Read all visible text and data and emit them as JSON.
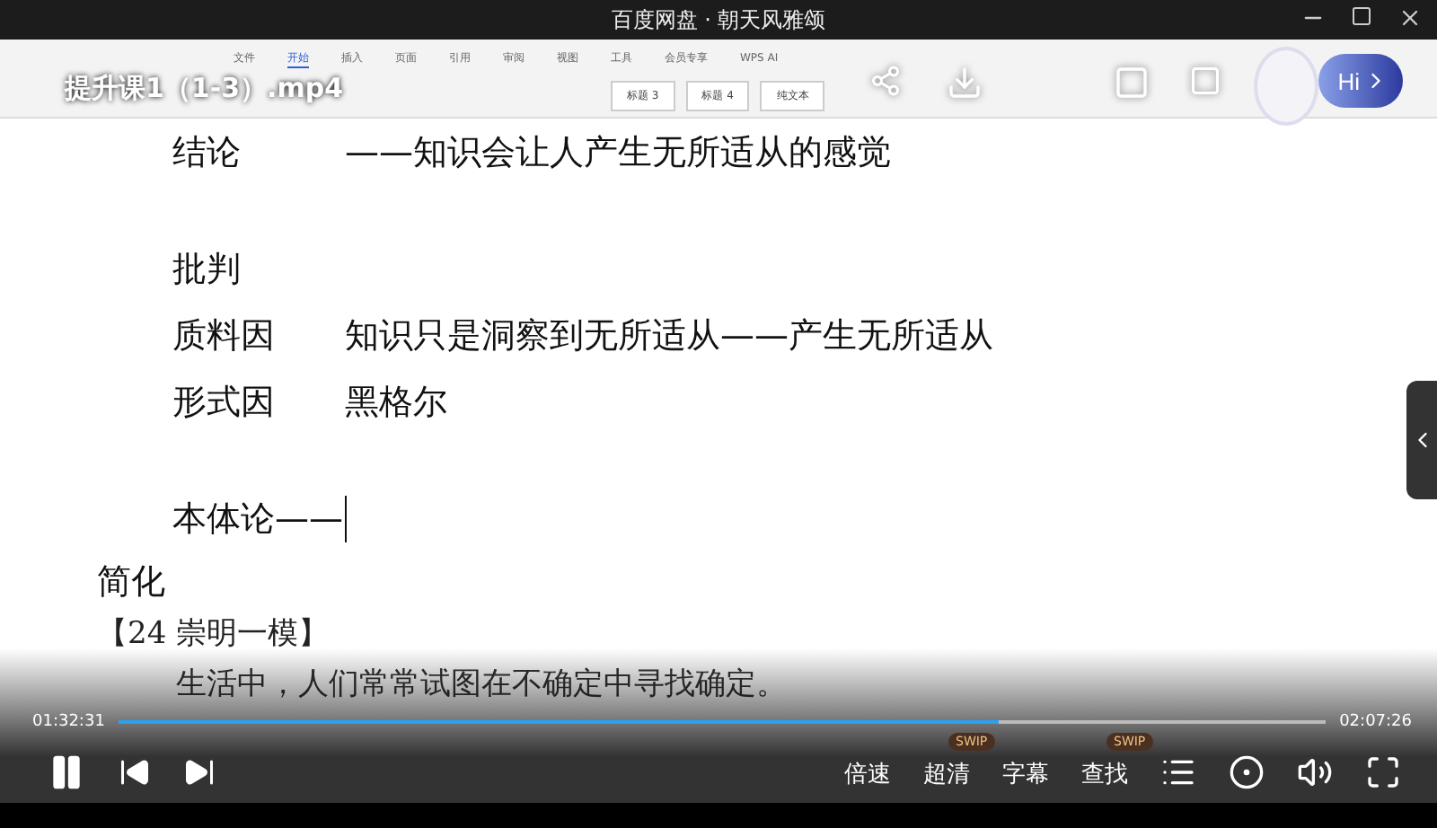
{
  "window": {
    "title": "百度网盘 · 朝天风雅颂"
  },
  "video": {
    "filename": "提升课1（1-3）.mp4",
    "playing": true,
    "current_time": "01:32:31",
    "duration": "02:07:26",
    "level": 0.73
  },
  "document": {
    "ribbon_tabs": [
      {
        "label": "文件",
        "selected": false
      },
      {
        "label": "开始",
        "selected": true
      },
      {
        "label": "插入",
        "selected": false
      },
      {
        "label": "页面",
        "selected": false
      },
      {
        "label": "引用",
        "selected": false
      },
      {
        "label": "审阅",
        "selected": false
      },
      {
        "label": "视图",
        "selected": false
      },
      {
        "label": "工具",
        "selected": false
      },
      {
        "label": "会员专享",
        "selected": false
      },
      {
        "label": "WPS AI",
        "selected": false
      }
    ],
    "styles": [
      "标题 3",
      "标题 4",
      "纯文本"
    ],
    "lines": [
      {
        "kind": "pair",
        "label": "结论",
        "text": "——知识会让人产生无所适从的感觉"
      },
      {
        "kind": "gap"
      },
      {
        "kind": "plain",
        "text": "批判"
      },
      {
        "kind": "pair",
        "label": "质料因",
        "text": "知识只是洞察到无所适从——产生无所适从"
      },
      {
        "kind": "pair",
        "label": "形式因",
        "text": "黑格尔"
      },
      {
        "kind": "gap"
      },
      {
        "kind": "cursor",
        "text": "本体论——"
      },
      {
        "kind": "heading",
        "text": "简化"
      },
      {
        "kind": "source",
        "text": "【24 崇明一模】"
      },
      {
        "kind": "quote",
        "text": "生活中，人们常常试图在不确定中寻找确定。"
      }
    ]
  },
  "assistant": {
    "label": "Hi"
  },
  "controls": [
    {
      "label": "倍速"
    },
    {
      "label": "超清",
      "badge": "SWIP"
    },
    {
      "label": "字幕"
    },
    {
      "label": "查找",
      "badge": "SWIP"
    }
  ]
}
